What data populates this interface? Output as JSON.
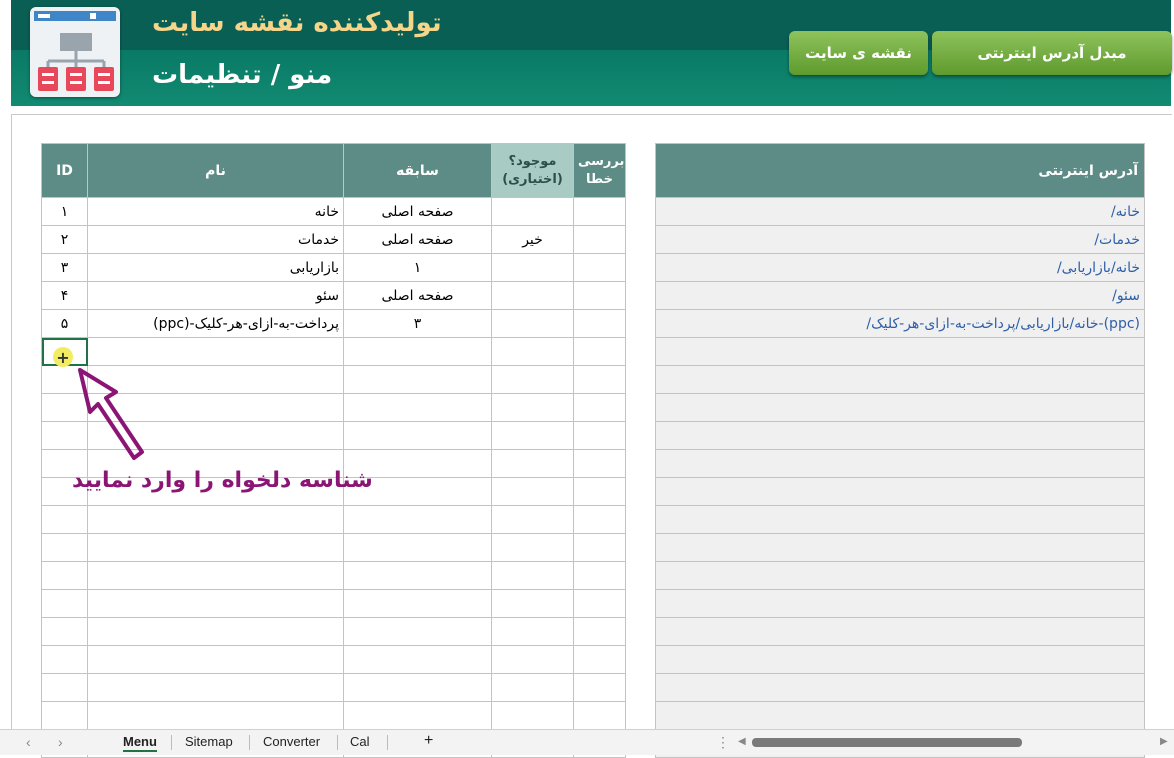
{
  "header": {
    "title": "تولیدکننده نقشه سایت",
    "subtitle": "منو / تنظیمات",
    "buttons": {
      "sitemap": "نقشه ی سایت",
      "converter": "مبدل آدرس اینترنتی"
    }
  },
  "table": {
    "headers": {
      "id": "ID",
      "name": "نام",
      "parent": "سابقه",
      "exists": "موجود؟\n(اختیاری)",
      "check": "بررسی\nخطا"
    },
    "rows": [
      {
        "id": "۱",
        "name": "خانه",
        "parent": "صفحه اصلی",
        "exists": "",
        "check": ""
      },
      {
        "id": "۲",
        "name": "خدمات",
        "parent": "صفحه اصلی",
        "exists": "خیر",
        "check": ""
      },
      {
        "id": "۳",
        "name": "بازاریابی",
        "parent": "۱",
        "exists": "",
        "check": ""
      },
      {
        "id": "۴",
        "name": "سئو",
        "parent": "صفحه اصلی",
        "exists": "",
        "check": ""
      },
      {
        "id": "۵",
        "name": "پرداخت-به-ازای-هر-کلیک-(ppc)",
        "parent": "۳",
        "exists": "",
        "check": ""
      }
    ]
  },
  "urls": {
    "header": "آدرس اینترنتی",
    "rows": [
      "/خانه",
      "/خدمات",
      "/خانه/بازاریابی",
      "/سئو",
      "/خانه/بازاریابی/پرداخت-به-ازای-هر-کلیک-(ppc)"
    ]
  },
  "hint": "شناسه دلخواه را وارد نمایید",
  "tabs": [
    "Menu",
    "Sitemap",
    "Converter",
    "Cal"
  ],
  "add_tab": "+",
  "colors": {
    "header_bg": "#0a7c67",
    "title": "#f4d58a",
    "button": "#6fa83a",
    "table_header": "#5c8c85",
    "hint": "#8b1575"
  }
}
